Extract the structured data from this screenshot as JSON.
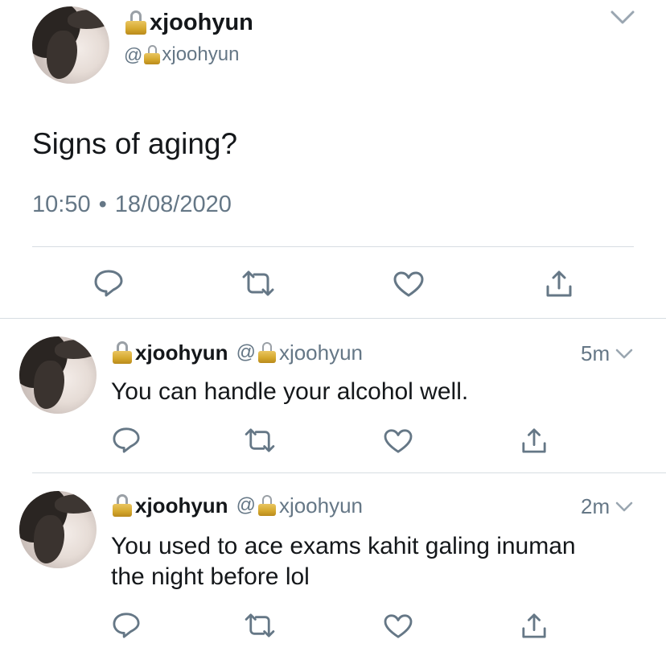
{
  "main_tweet": {
    "display_name": "xjoohyun",
    "handle_at": "@",
    "handle": "xjoohyun",
    "text": "Signs of aging?",
    "time": "10:50",
    "dot": "•",
    "date": "18/08/2020"
  },
  "replies": [
    {
      "display_name": "xjoohyun",
      "handle_at": "@",
      "handle": "xjoohyun",
      "age": "5m",
      "text": "You can handle your alcohol well."
    },
    {
      "display_name": "xjoohyun",
      "handle_at": "@",
      "handle": "xjoohyun",
      "age": "2m",
      "text_line1": "You used to ace exams kahit galing inuman",
      "text_line2": "the night before lol"
    }
  ],
  "icons": [
    "lock-icon",
    "chevron-down-icon",
    "reply-icon",
    "retweet-icon",
    "like-icon",
    "share-icon"
  ],
  "colors": {
    "icon_gray": "#657786",
    "text": "#14171a",
    "divider": "#d7dde2"
  }
}
